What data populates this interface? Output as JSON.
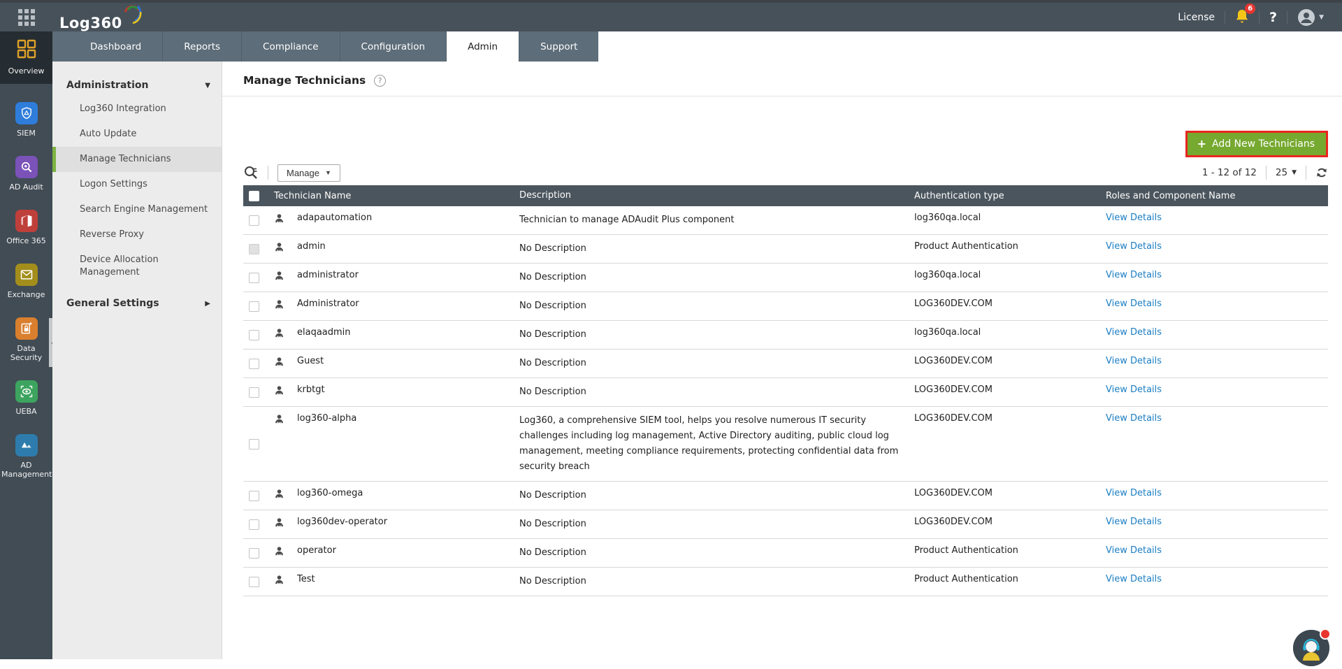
{
  "topbar": {
    "logo_text": "Log360",
    "license_label": "License",
    "notification_count": "6",
    "help_label": "?"
  },
  "nav": {
    "tabs": [
      {
        "label": "Dashboard",
        "active": false
      },
      {
        "label": "Reports",
        "active": false
      },
      {
        "label": "Compliance",
        "active": false
      },
      {
        "label": "Configuration",
        "active": false
      },
      {
        "label": "Admin",
        "active": true
      },
      {
        "label": "Support",
        "active": false
      }
    ]
  },
  "sidebar": {
    "items": [
      {
        "label": "Overview",
        "icon": "overview-grid-icon",
        "color": "#dfa228",
        "active": true
      },
      {
        "label": "SIEM",
        "icon": "shield-icon",
        "color": "#2e7ddb"
      },
      {
        "label": "AD Audit",
        "icon": "audit-magnifier-icon",
        "color": "#7a52b8"
      },
      {
        "label": "Office 365",
        "icon": "office365-icon",
        "color": "#bf3f3a"
      },
      {
        "label": "Exchange",
        "icon": "envelope-icon",
        "color": "#a38e1c"
      },
      {
        "label": "Data Security",
        "icon": "secure-document-icon",
        "color": "#d97f2e"
      },
      {
        "label": "UEBA",
        "icon": "eye-icon",
        "color": "#3da45f"
      },
      {
        "label": "AD Management",
        "icon": "mountains-icon",
        "color": "#2d7cad"
      }
    ]
  },
  "menu": {
    "section_label": "Administration",
    "items": [
      {
        "label": "Log360 Integration",
        "selected": false
      },
      {
        "label": "Auto Update",
        "selected": false
      },
      {
        "label": "Manage Technicians",
        "selected": true
      },
      {
        "label": "Logon Settings",
        "selected": false
      },
      {
        "label": "Search Engine Management",
        "selected": false
      },
      {
        "label": "Reverse Proxy",
        "selected": false
      },
      {
        "label": "Device Allocation Management",
        "selected": false
      }
    ],
    "general_section_label": "General Settings"
  },
  "page": {
    "title": "Manage Technicians",
    "add_button_label": "Add New Technicians",
    "manage_button_label": "Manage",
    "pagination_range": "1 - 12 of 12",
    "page_size": "25"
  },
  "table": {
    "columns": [
      "Technician Name",
      "Description",
      "Authentication type",
      "Roles and Component Name"
    ],
    "link_label": "View Details",
    "rows": [
      {
        "name": "adapautomation",
        "description": "Technician to manage ADAudit Plus component",
        "auth": "log360qa.local",
        "checkbox_disabled": false
      },
      {
        "name": "admin",
        "description": "No Description",
        "auth": "Product Authentication",
        "checkbox_disabled": true
      },
      {
        "name": "administrator",
        "description": "No Description",
        "auth": "log360qa.local",
        "checkbox_disabled": false
      },
      {
        "name": "Administrator",
        "description": "No Description",
        "auth": "LOG360DEV.COM",
        "checkbox_disabled": false
      },
      {
        "name": "elaqaadmin",
        "description": "No Description",
        "auth": "log360qa.local",
        "checkbox_disabled": false
      },
      {
        "name": "Guest",
        "description": "No Description",
        "auth": "LOG360DEV.COM",
        "checkbox_disabled": false
      },
      {
        "name": "krbtgt",
        "description": "No Description",
        "auth": "LOG360DEV.COM",
        "checkbox_disabled": false
      },
      {
        "name": "log360-alpha",
        "description": "Log360, a comprehensive SIEM tool, helps you resolve numerous IT security challenges including log management, Active Directory auditing, public cloud log management, meeting compliance requirements, protecting confidential data from security breach",
        "auth": "LOG360DEV.COM",
        "checkbox_disabled": false
      },
      {
        "name": "log360-omega",
        "description": "No Description",
        "auth": "LOG360DEV.COM",
        "checkbox_disabled": false
      },
      {
        "name": "log360dev-operator",
        "description": "No Description",
        "auth": "LOG360DEV.COM",
        "checkbox_disabled": false
      },
      {
        "name": "operator",
        "description": "No Description",
        "auth": "Product Authentication",
        "checkbox_disabled": false
      },
      {
        "name": "Test",
        "description": "No Description",
        "auth": "Product Authentication",
        "checkbox_disabled": false
      }
    ]
  },
  "colors": {
    "topbar_bg": "#47515a",
    "tabstrip_bg": "#5d6d79",
    "iconbar_bg": "#414c55",
    "menu_bg": "#ececec",
    "selected_green": "#7cb342",
    "table_header_bg": "#4b555d",
    "add_button_green": "#76a92f",
    "highlight_red": "#e8261f",
    "link_blue": "#1b7ec3",
    "bell_yellow": "#f5c518"
  }
}
